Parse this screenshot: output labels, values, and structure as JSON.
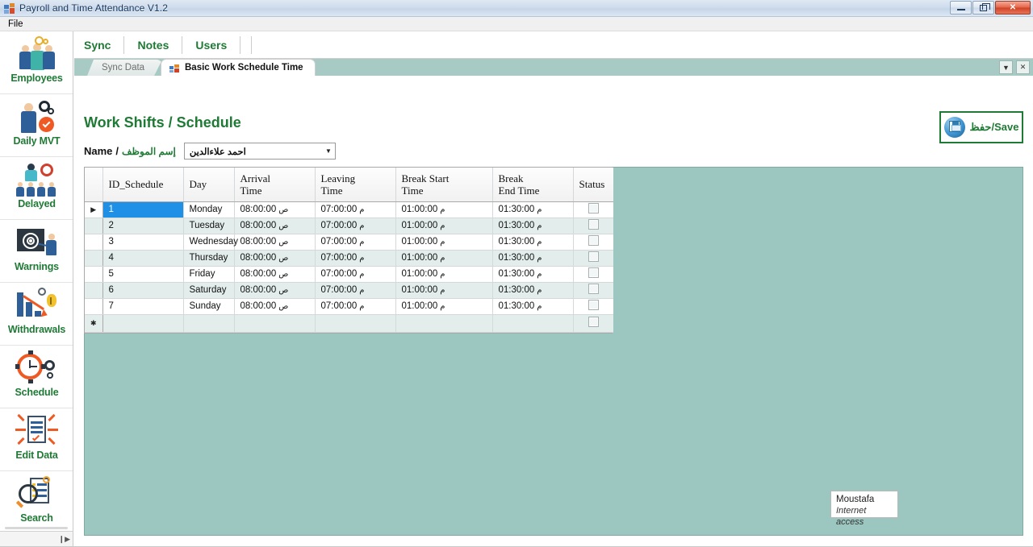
{
  "window": {
    "title": "Payroll and Time Attendance V1.2",
    "icon": "app-window-icon",
    "minimize_label": "",
    "restore_label": "",
    "close_label": "✕"
  },
  "menubar": {
    "items": [
      {
        "label": "File"
      }
    ]
  },
  "sidebar": {
    "items": [
      {
        "label": "Employees",
        "icon": "employees-group-icon"
      },
      {
        "label": "Daily MVT",
        "icon": "daily-movement-icon"
      },
      {
        "label": "Delayed",
        "icon": "delayed-icon"
      },
      {
        "label": "Warnings",
        "icon": "warnings-target-icon"
      },
      {
        "label": "Withdrawals",
        "icon": "withdrawals-chart-icon"
      },
      {
        "label": "Schedule",
        "icon": "schedule-clock-icon"
      },
      {
        "label": "Edit Data",
        "icon": "edit-data-document-icon"
      },
      {
        "label": "Search",
        "icon": "search-magnifier-icon"
      }
    ],
    "expand_arrow": "❙▶"
  },
  "topnav": {
    "items": [
      {
        "label": "Sync"
      },
      {
        "label": "Notes"
      },
      {
        "label": "Users"
      }
    ]
  },
  "tabstrip": {
    "tabs": [
      {
        "label": "Sync Data",
        "active": false
      },
      {
        "label": "Basic Work Schedule Time",
        "active": true,
        "icon": "tab-window-icon"
      }
    ],
    "controls": [
      {
        "name": "tab-list-dropdown",
        "glyph": "▼"
      },
      {
        "name": "tab-close",
        "glyph": "✕"
      }
    ]
  },
  "page": {
    "title": "Work  Shifts / Schedule",
    "name_label_en": "Name",
    "name_label_separator": "/",
    "name_label_ar": "إسم الموظف",
    "name_selected": "احمد علاءالدين",
    "name_caret": "▼",
    "save_label": "Save/حفظ",
    "save_icon": "save-floppy-icon"
  },
  "grid": {
    "columns": [
      {
        "key": "rowsel",
        "label": ""
      },
      {
        "key": "id",
        "label": "ID_Schedule"
      },
      {
        "key": "day",
        "label": "Day"
      },
      {
        "key": "arrival",
        "label": "Arrival\nTime"
      },
      {
        "key": "leaving",
        "label": "Leaving\nTime"
      },
      {
        "key": "bstart",
        "label": "Break Start\nTime"
      },
      {
        "key": "bend",
        "label": "Break\nEnd Time"
      },
      {
        "key": "status",
        "label": "Status"
      }
    ],
    "column_labels": {
      "id": "ID_Schedule",
      "day": "Day",
      "arrival_l1": "Arrival",
      "arrival_l2": "Time",
      "leaving_l1": "Leaving",
      "leaving_l2": "Time",
      "bstart_l1": "Break Start",
      "bstart_l2": "Time",
      "bend_l1": "Break",
      "bend_l2": "End Time",
      "status": "Status"
    },
    "rows": [
      {
        "marker": "▶",
        "id": "1",
        "day": "Monday",
        "arrival": "08:00:00",
        "arrival_ampm": "ص",
        "leaving": "07:00:00",
        "leaving_ampm": "م",
        "bstart": "01:00:00",
        "bstart_ampm": "م",
        "bend": "01:30:00",
        "bend_ampm": "م",
        "status_checked": false,
        "selected": true
      },
      {
        "marker": "",
        "id": "2",
        "day": "Tuesday",
        "arrival": "08:00:00",
        "arrival_ampm": "ص",
        "leaving": "07:00:00",
        "leaving_ampm": "م",
        "bstart": "01:00:00",
        "bstart_ampm": "م",
        "bend": "01:30:00",
        "bend_ampm": "م",
        "status_checked": false,
        "selected": false
      },
      {
        "marker": "",
        "id": "3",
        "day": "Wednesday",
        "arrival": "08:00:00",
        "arrival_ampm": "ص",
        "leaving": "07:00:00",
        "leaving_ampm": "م",
        "bstart": "01:00:00",
        "bstart_ampm": "م",
        "bend": "01:30:00",
        "bend_ampm": "م",
        "status_checked": false,
        "selected": false
      },
      {
        "marker": "",
        "id": "4",
        "day": "Thursday",
        "arrival": "08:00:00",
        "arrival_ampm": "ص",
        "leaving": "07:00:00",
        "leaving_ampm": "م",
        "bstart": "01:00:00",
        "bstart_ampm": "م",
        "bend": "01:30:00",
        "bend_ampm": "م",
        "status_checked": false,
        "selected": false
      },
      {
        "marker": "",
        "id": "5",
        "day": "Friday",
        "arrival": "08:00:00",
        "arrival_ampm": "ص",
        "leaving": "07:00:00",
        "leaving_ampm": "م",
        "bstart": "01:00:00",
        "bstart_ampm": "م",
        "bend": "01:30:00",
        "bend_ampm": "م",
        "status_checked": false,
        "selected": false
      },
      {
        "marker": "",
        "id": "6",
        "day": "Saturday",
        "arrival": "08:00:00",
        "arrival_ampm": "ص",
        "leaving": "07:00:00",
        "leaving_ampm": "م",
        "bstart": "01:00:00",
        "bstart_ampm": "م",
        "bend": "01:30:00",
        "bend_ampm": "م",
        "status_checked": false,
        "selected": false
      },
      {
        "marker": "",
        "id": "7",
        "day": "Sunday",
        "arrival": "08:00:00",
        "arrival_ampm": "ص",
        "leaving": "07:00:00",
        "leaving_ampm": "م",
        "bstart": "01:00:00",
        "bstart_ampm": "م",
        "bend": "01:30:00",
        "bend_ampm": "م",
        "status_checked": false,
        "selected": false
      }
    ],
    "new_row": {
      "marker": "✱",
      "id": "",
      "day": "",
      "arrival": "",
      "leaving": "",
      "bstart": "",
      "bend": "",
      "status_checked": false
    }
  },
  "tooltip": {
    "title": "Moustafa",
    "subtitle": "Internet access"
  },
  "colors": {
    "brand_green": "#1f7a35",
    "canvas_teal": "#9cc6c0",
    "row_alt": "#e3eeec",
    "selection_blue": "#1e90e5",
    "titlebar_blue": "#cfdced",
    "close_red": "#cf4226"
  }
}
